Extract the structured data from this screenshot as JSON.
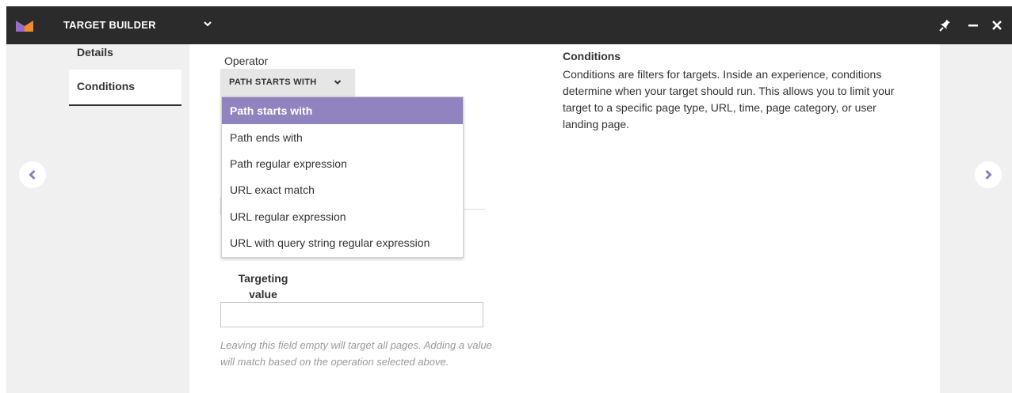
{
  "titlebar": {
    "app_title": "TARGET BUILDER",
    "logo_colors": [
      "#9b6bcc",
      "#f28c28"
    ]
  },
  "icons": {
    "title_dropdown": "chevron-down-icon",
    "pin": "pin-icon",
    "minimize": "minimize-icon",
    "close": "close-icon",
    "prev": "chevron-left-icon",
    "next": "chevron-right-icon"
  },
  "sidebar": {
    "items": [
      {
        "label": "Details",
        "active": false
      },
      {
        "label": "Conditions",
        "active": true
      }
    ]
  },
  "operator": {
    "label": "Operator",
    "selected_display": "PATH STARTS WITH",
    "options": [
      {
        "label": "Path starts with",
        "selected": true
      },
      {
        "label": "Path ends with",
        "selected": false
      },
      {
        "label": "Path regular expression",
        "selected": false
      },
      {
        "label": "URL exact match",
        "selected": false
      },
      {
        "label": "URL regular expression",
        "selected": false
      },
      {
        "label": "URL with query string regular expression",
        "selected": false
      }
    ]
  },
  "targeting_value": {
    "label_line1": "Targeting",
    "label_line2": "value",
    "value": "",
    "hint": "Leaving this field empty will target all pages. Adding a value will match based on the operation selected above."
  },
  "info": {
    "title": "Conditions",
    "body": "Conditions are filters for targets. Inside an experience, conditions determine when your target should run. This allows you to limit your target to a specific page type, URL, time, page category, or user landing page."
  },
  "colors": {
    "titlebar_bg": "#2b2b2b",
    "accent": "#9083bf",
    "nav_arrow": "#8a7fbf"
  }
}
